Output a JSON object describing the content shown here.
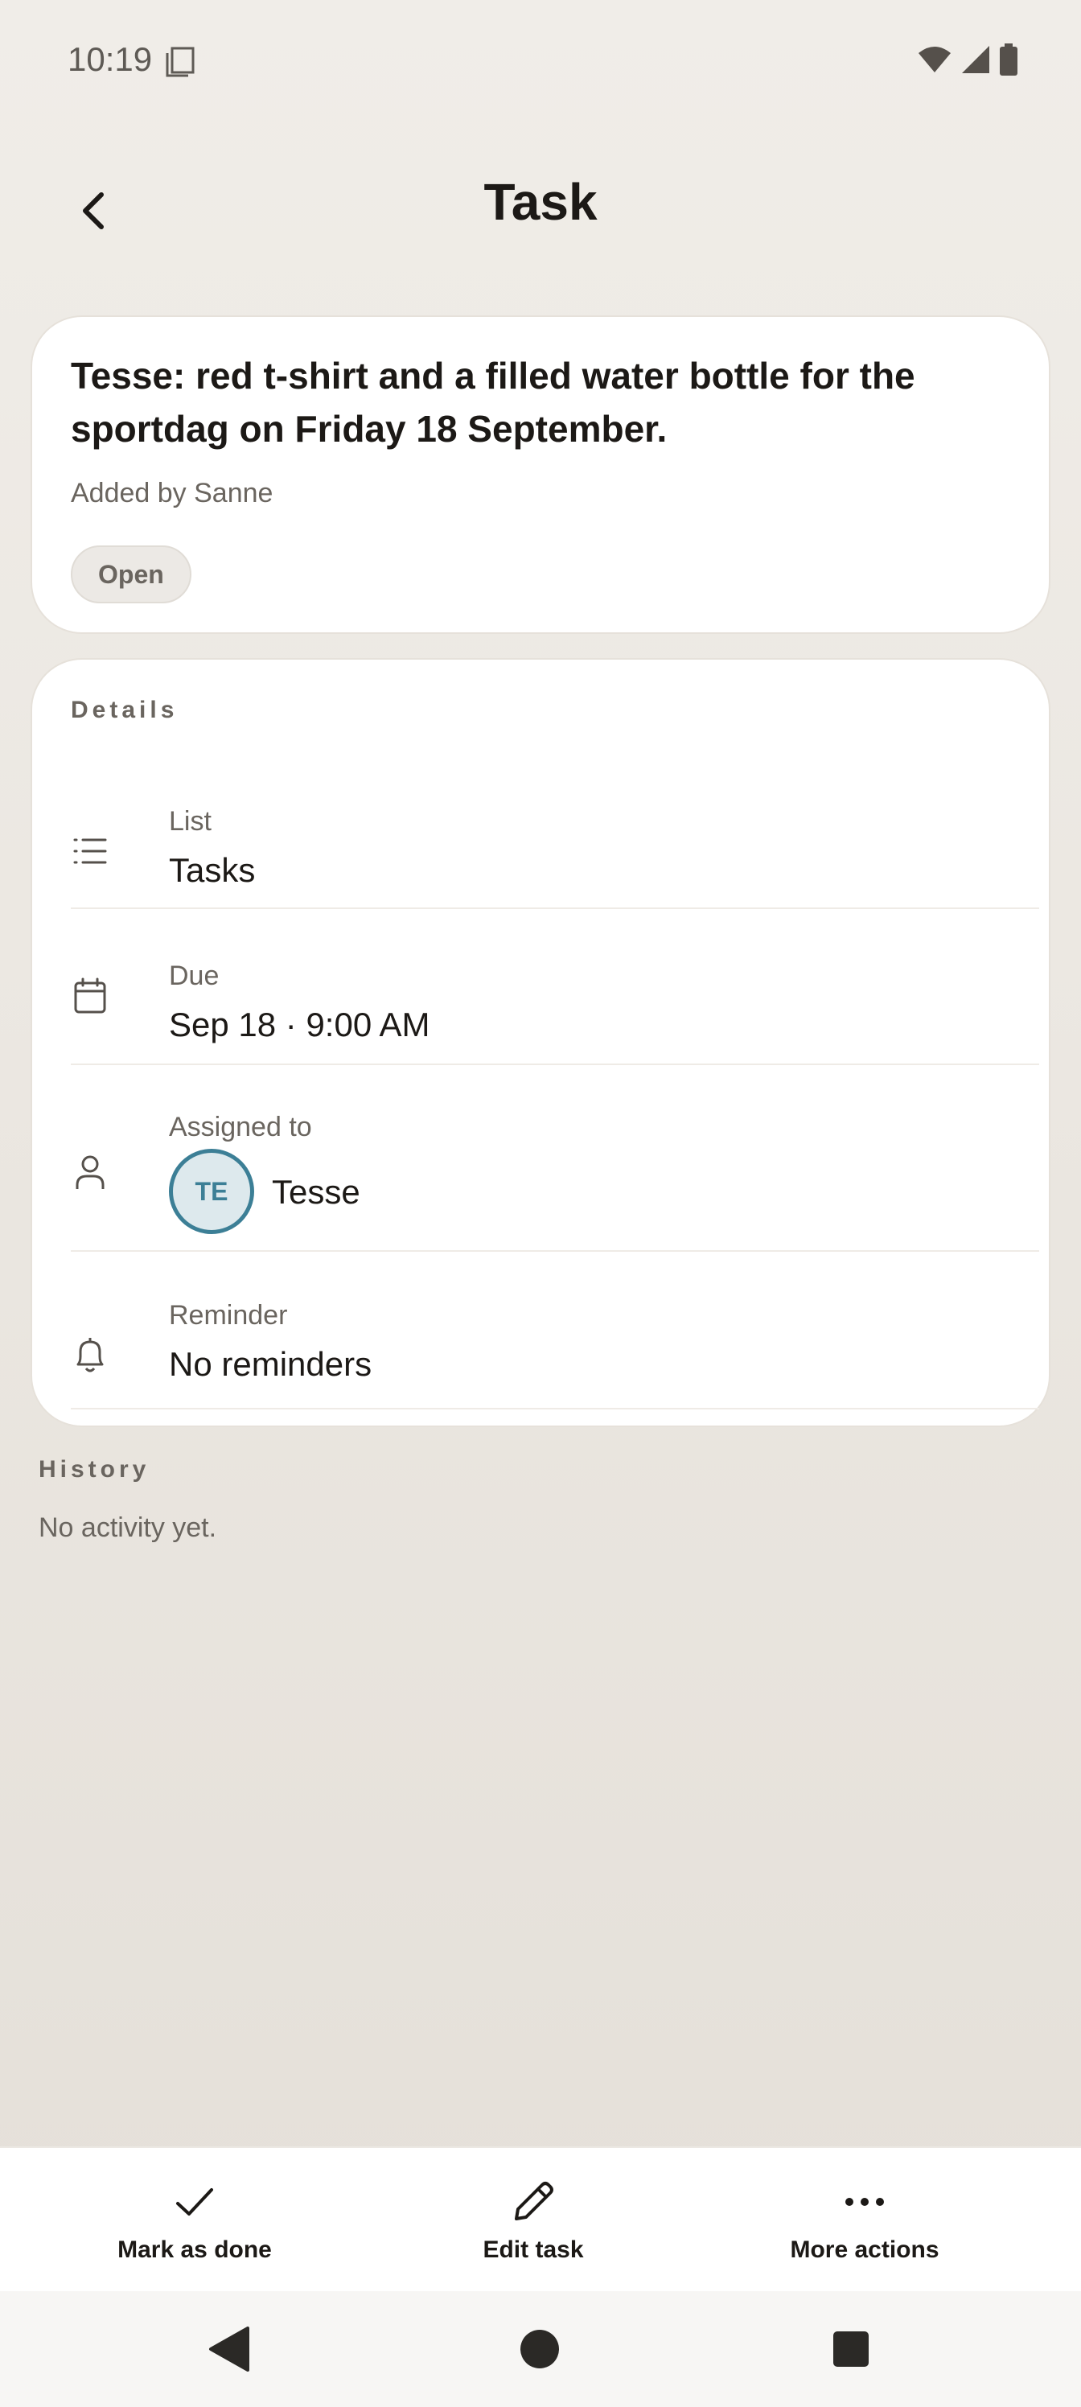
{
  "status_bar": {
    "time": "10:19",
    "icons": [
      "document-icon",
      "wifi-icon",
      "cellular-icon",
      "battery-icon"
    ]
  },
  "header": {
    "title": "Task",
    "back_icon": "chevron-left-icon"
  },
  "task": {
    "title": "Tesse: red t-shirt and a filled water bottle for the sportdag on Friday 18 September.",
    "added_by": "Added by Sanne",
    "status": "Open"
  },
  "details": {
    "section_label": "Details",
    "list": {
      "label": "List",
      "value": "Tasks",
      "icon": "list-icon"
    },
    "due": {
      "label": "Due",
      "value": "Sep 18 · 9:00 AM",
      "icon": "calendar-icon"
    },
    "assigned": {
      "label": "Assigned to",
      "initials": "TE",
      "name": "Tesse",
      "icon": "person-icon"
    },
    "reminder": {
      "label": "Reminder",
      "value": "No reminders",
      "icon": "bell-icon"
    }
  },
  "history": {
    "section_label": "History",
    "empty_text": "No activity yet."
  },
  "actions": {
    "done": {
      "label": "Mark as done",
      "icon": "checkmark-icon"
    },
    "edit": {
      "label": "Edit task",
      "icon": "pencil-icon"
    },
    "more": {
      "label": "More actions",
      "icon": "more-dots-icon"
    }
  },
  "colors": {
    "background": "#ece8e2",
    "card": "#ffffff",
    "text_primary": "#1c1916",
    "text_secondary": "#6a655f",
    "avatar_accent": "#3c7f96",
    "avatar_fill": "#dde9ed"
  }
}
